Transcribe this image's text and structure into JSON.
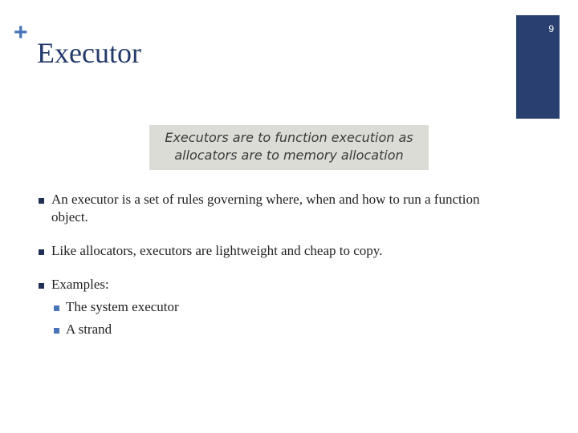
{
  "slide": {
    "decoration_symbol": "+",
    "title": "Executor",
    "page_number": "9",
    "accent_color": "#4a74b8",
    "title_color": "#243a6b",
    "page_tab_color": "#283f70",
    "quote_box_color": "#dcdcd7"
  },
  "quote": {
    "line1": "Executors are to function execution as",
    "line2": "allocators are to memory allocation"
  },
  "bullets": [
    {
      "text": "An executor is a set of rules governing where, when and how to run a function object."
    },
    {
      "text": "Like allocators, executors are lightweight and cheap to copy."
    },
    {
      "text": "Examples:",
      "children": [
        {
          "text": "The system executor"
        },
        {
          "text": "A strand"
        }
      ]
    }
  ]
}
